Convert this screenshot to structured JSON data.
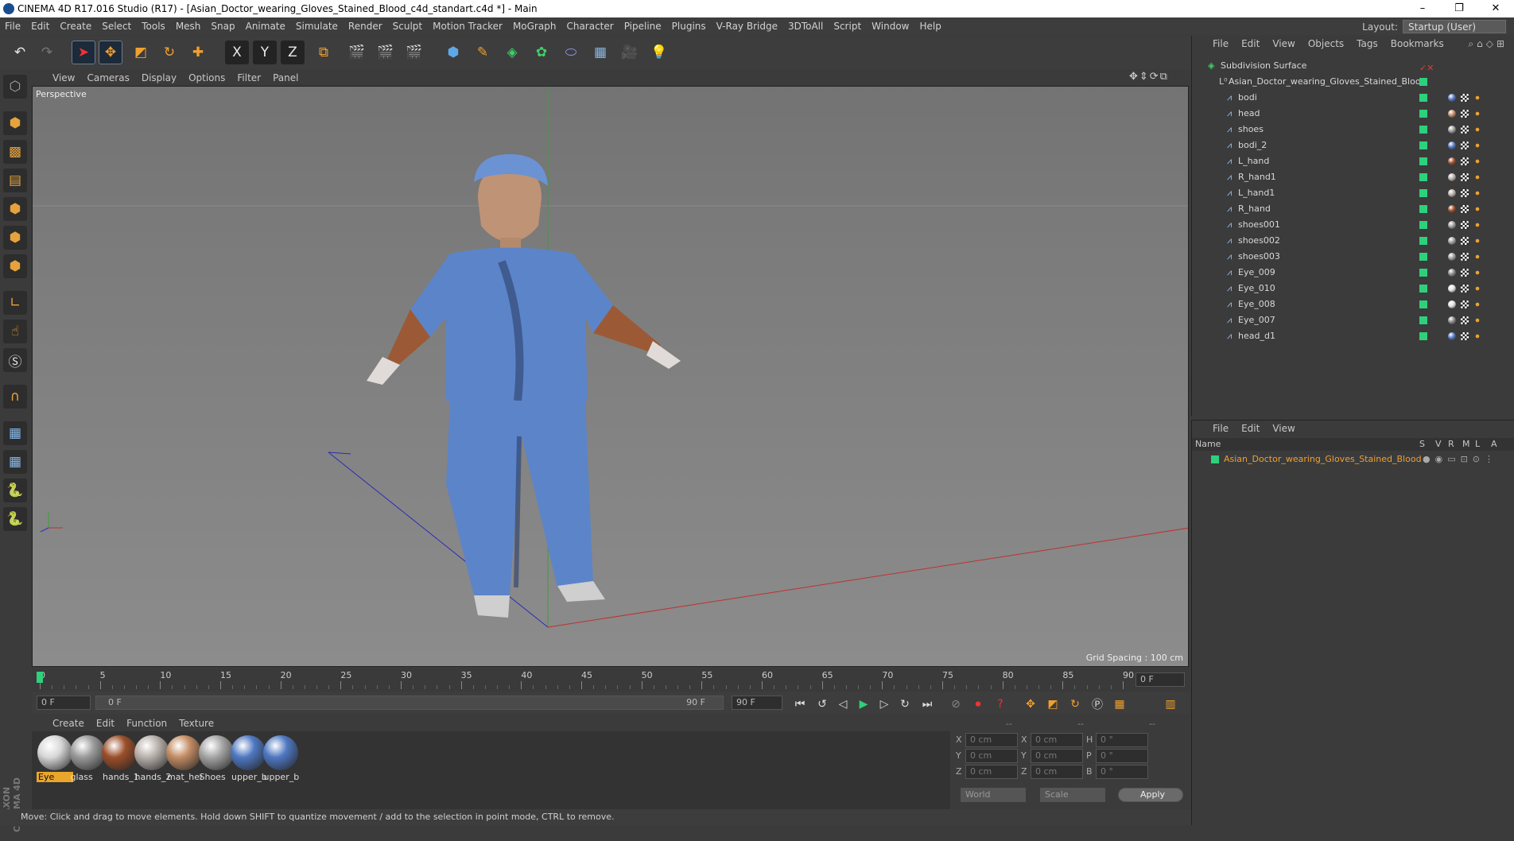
{
  "window": {
    "title": "CINEMA 4D R17.016 Studio (R17) - [Asian_Doctor_wearing_Gloves_Stained_Blood_c4d_standart.c4d *] - Main",
    "controls": [
      "–",
      "❐",
      "✕"
    ]
  },
  "menu": [
    "File",
    "Edit",
    "Create",
    "Select",
    "Tools",
    "Mesh",
    "Snap",
    "Animate",
    "Simulate",
    "Render",
    "Sculpt",
    "Motion Tracker",
    "MoGraph",
    "Character",
    "Pipeline",
    "Plugins",
    "V-Ray Bridge",
    "3DToAll",
    "Script",
    "Window",
    "Help"
  ],
  "layout": {
    "label": "Layout:",
    "value": "Startup (User)"
  },
  "toolbar": {
    "undo": "↶",
    "redo": "↷",
    "axis": [
      "X",
      "Y",
      "Z"
    ]
  },
  "viewport": {
    "menu": [
      "View",
      "Cameras",
      "Display",
      "Options",
      "Filter",
      "Panel"
    ],
    "label": "Perspective",
    "grid_spacing": "Grid Spacing : 100 cm"
  },
  "timeline": {
    "ticks": [
      "0",
      "5",
      "10",
      "15",
      "20",
      "25",
      "30",
      "35",
      "40",
      "45",
      "50",
      "55",
      "60",
      "65",
      "70",
      "75",
      "80",
      "85",
      "90"
    ],
    "current": "0 F"
  },
  "controls": {
    "start": "0 F",
    "range_start": "0 F",
    "range_end": "90 F",
    "end": "90 F"
  },
  "materials": {
    "menu": [
      "Create",
      "Edit",
      "Function",
      "Texture"
    ],
    "items": [
      {
        "name": "Eye",
        "color": "#d8d8d8",
        "selected": true
      },
      {
        "name": "glass",
        "color": "#9a9a9a"
      },
      {
        "name": "hands_1",
        "color": "#9b4f2a"
      },
      {
        "name": "hands_2",
        "color": "#b9b1ab"
      },
      {
        "name": "mat_hea",
        "color": "#c38c64"
      },
      {
        "name": "Shoes",
        "color": "#a5a5a5"
      },
      {
        "name": "upper_b",
        "color": "#4f78c2"
      },
      {
        "name": "upper_b",
        "color": "#4f78c2"
      }
    ]
  },
  "coords": {
    "header": [
      "--",
      "--",
      "--"
    ],
    "rows": [
      {
        "a": "X",
        "av": "0 cm",
        "b": "X",
        "bv": "0 cm",
        "c": "H",
        "cv": "0 °"
      },
      {
        "a": "Y",
        "av": "0 cm",
        "b": "Y",
        "bv": "0 cm",
        "c": "P",
        "cv": "0 °"
      },
      {
        "a": "Z",
        "av": "0 cm",
        "b": "Z",
        "bv": "0 cm",
        "c": "B",
        "cv": "0 °"
      }
    ],
    "world": "World",
    "scale": "Scale",
    "apply": "Apply"
  },
  "status": "Move: Click and drag to move elements. Hold down SHIFT to quantize movement / add to the selection in point mode, CTRL to remove.",
  "objects": {
    "menu": [
      "File",
      "Edit",
      "View",
      "Objects",
      "Tags",
      "Bookmarks"
    ],
    "root": "Subdivision Surface",
    "group": "Asian_Doctor_wearing_Gloves_Stained_Blood",
    "items": [
      {
        "name": "bodi",
        "tag": "#5578c0"
      },
      {
        "name": "head",
        "tag": "#c08c6a"
      },
      {
        "name": "shoes",
        "tag": "#9d9d9d"
      },
      {
        "name": "bodi_2",
        "tag": "#5578c0"
      },
      {
        "name": "L_hand",
        "tag": "#9b4f2a"
      },
      {
        "name": "R_hand1",
        "tag": "#b8b0aa"
      },
      {
        "name": "L_hand1",
        "tag": "#b8b0aa"
      },
      {
        "name": "R_hand",
        "tag": "#9b4f2a"
      },
      {
        "name": "shoes001",
        "tag": "#9d9d9d"
      },
      {
        "name": "shoes002",
        "tag": "#9d9d9d"
      },
      {
        "name": "shoes003",
        "tag": "#9d9d9d"
      },
      {
        "name": "Eye_009",
        "tag": "#8a8a8a"
      },
      {
        "name": "Eye_010",
        "tag": "#e0e0e0"
      },
      {
        "name": "Eye_008",
        "tag": "#e0e0e0"
      },
      {
        "name": "Eye_007",
        "tag": "#8a8a8a"
      },
      {
        "name": "head_d1",
        "tag": "#5578c0"
      }
    ]
  },
  "layers": {
    "menu": [
      "File",
      "Edit",
      "View"
    ],
    "cols": [
      "Name",
      "S",
      "V",
      "R",
      "M",
      "L",
      "A"
    ],
    "item": "Asian_Doctor_wearing_Gloves_Stained_Blood"
  }
}
